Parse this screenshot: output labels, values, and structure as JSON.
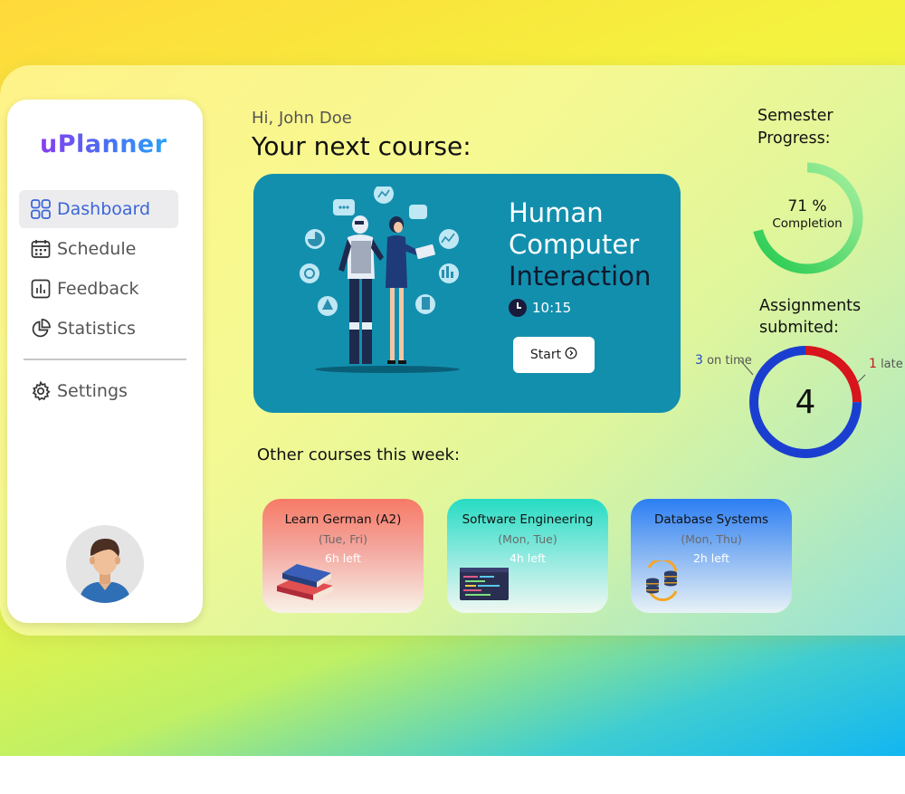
{
  "app": {
    "name": "uPlanner"
  },
  "sidebar": {
    "items": [
      {
        "label": "Dashboard",
        "icon": "dashboard-grid-icon",
        "active": true
      },
      {
        "label": "Schedule",
        "icon": "calendar-icon"
      },
      {
        "label": "Feedback",
        "icon": "feedback-chart-icon"
      },
      {
        "label": "Statistics",
        "icon": "pie-chart-icon"
      }
    ],
    "settings": {
      "label": "Settings",
      "icon": "gear-icon"
    },
    "avatar": "user-avatar"
  },
  "header": {
    "greeting": "Hi, John Doe",
    "title": "Your next course:"
  },
  "next_course": {
    "name_line1": "Human",
    "name_line2": "Computer",
    "name_line3": "Interaction",
    "time": "10:15",
    "start_label": "Start"
  },
  "other": {
    "title": "Other courses this week:",
    "courses": [
      {
        "name": "Learn German (A2)",
        "days": "(Tue, Fri)",
        "left": "6h left",
        "icon": "books-icon"
      },
      {
        "name": "Software Engineering",
        "days": "(Mon, Tue)",
        "left": "4h left",
        "icon": "code-window-icon"
      },
      {
        "name": "Database Systems",
        "days": "(Mon, Thu)",
        "left": "2h left",
        "icon": "database-icon"
      }
    ]
  },
  "semester": {
    "title_line1": "Semester",
    "title_line2": "Progress:",
    "percent": "71 %",
    "completion_label": "Completion",
    "fraction": 0.71
  },
  "assignments": {
    "title_line1": "Assignments",
    "title_line2": "submited:",
    "total": "4",
    "on_time_count": "3",
    "on_time_label": "on time",
    "late_count": "1",
    "late_label": "late",
    "colors": {
      "on_time": "#1a3fd0",
      "late": "#d8141c"
    }
  }
}
